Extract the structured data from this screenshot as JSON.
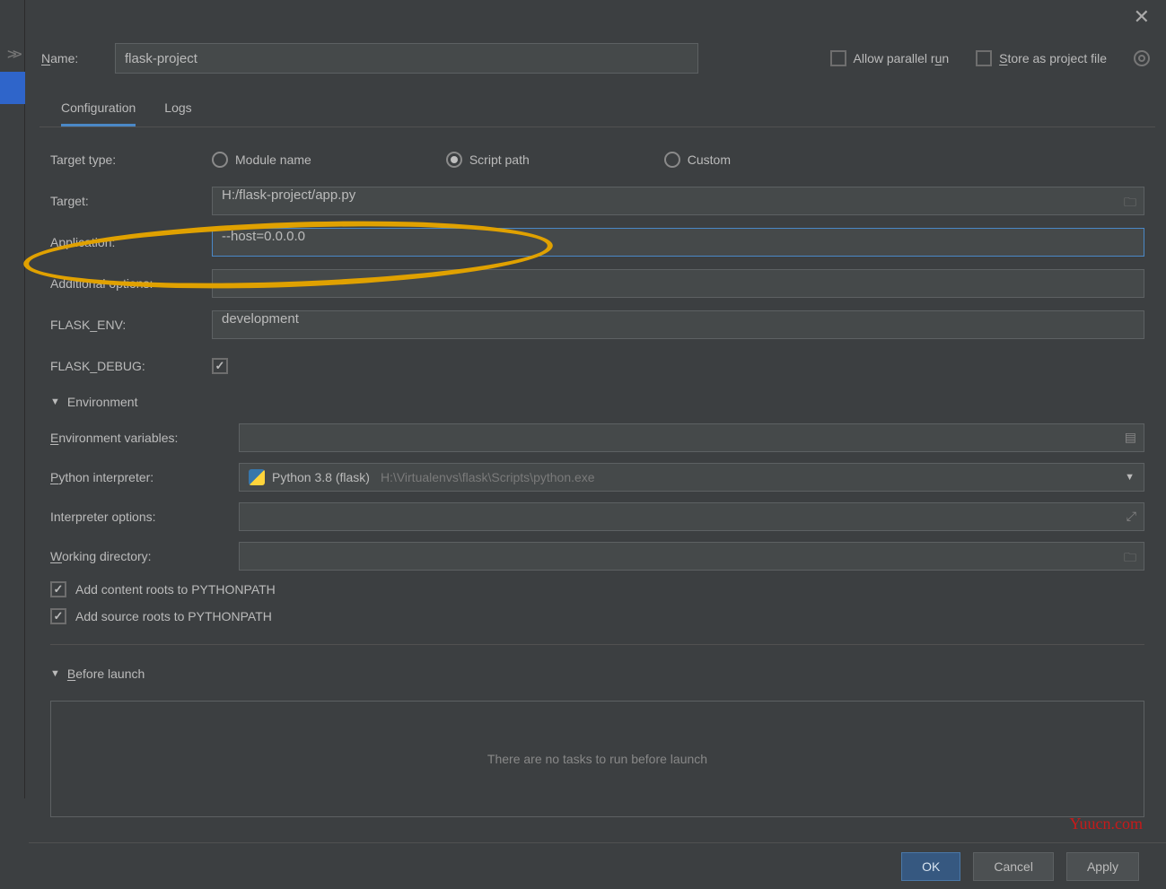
{
  "header": {
    "name_label": "Name:",
    "name_value": "flask-project",
    "allow_parallel_label": "Allow parallel run",
    "store_project_label": "Store as project file"
  },
  "tabs": {
    "configuration": "Configuration",
    "logs": "Logs"
  },
  "form": {
    "target_type_label": "Target type:",
    "target_type_options": {
      "module": "Module name",
      "script": "Script path",
      "custom": "Custom"
    },
    "target_label": "Target:",
    "target_value": "H:/flask-project/app.py",
    "application_label": "Application:",
    "application_value": "--host=0.0.0.0",
    "additional_options_label": "Additional options:",
    "additional_options_value": "",
    "flask_env_label": "FLASK_ENV:",
    "flask_env_value": "development",
    "flask_debug_label": "FLASK_DEBUG:",
    "environment_section": "Environment",
    "env_vars_label": "Environment variables:",
    "env_vars_value": "",
    "python_interpreter_label": "Python interpreter:",
    "python_interpreter_name": "Python 3.8 (flask)",
    "python_interpreter_path": "H:\\Virtualenvs\\flask\\Scripts\\python.exe",
    "interpreter_options_label": "Interpreter options:",
    "interpreter_options_value": "",
    "working_dir_label": "Working directory:",
    "working_dir_value": "",
    "add_content_roots": "Add content roots to PYTHONPATH",
    "add_source_roots": "Add source roots to PYTHONPATH",
    "before_launch_label": "Before launch",
    "before_launch_empty": "There are no tasks to run before launch"
  },
  "footer": {
    "ok": "OK",
    "cancel": "Cancel",
    "apply": "Apply"
  },
  "watermark": "Yuucn.com"
}
